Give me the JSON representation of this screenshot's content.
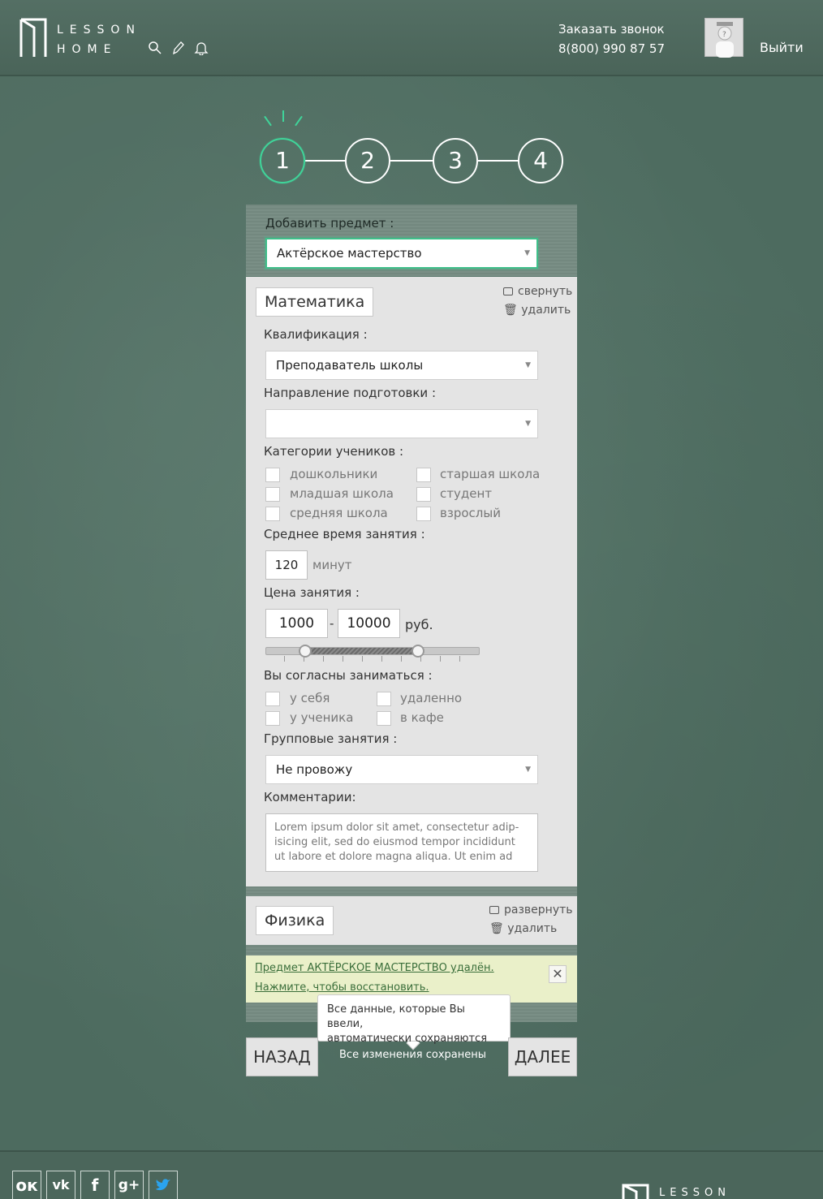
{
  "header": {
    "logo_line1": "LESSON",
    "logo_line2": "HOME",
    "callback_label": "Заказать звонок",
    "phone": "8(800) 990 87 57",
    "logout_label": "Выйти"
  },
  "steps": [
    "1",
    "2",
    "3",
    "4"
  ],
  "add_subject": {
    "label": "Добавить предмет :",
    "selected": "Актёрское мастерство"
  },
  "subject1": {
    "name": "Математика",
    "collapse_label": "свернуть",
    "delete_label": "удалить",
    "qualification_label": "Квалификация :",
    "qualification_value": "Преподаватель школы",
    "direction_label": "Направление подготовки :",
    "direction_value": "",
    "categories_label": "Категории учеников :",
    "categories": [
      "дошкольники",
      "старшая школа",
      "младшая школа",
      "студент",
      "средняя школа",
      "взрослый"
    ],
    "duration_label": "Среднее время занятия :",
    "duration_value": "120",
    "duration_unit": "минут",
    "price_label": "Цена занятия :",
    "price_min": "1000",
    "price_sep": "-",
    "price_max": "10000",
    "price_unit": "руб.",
    "location_label": "Вы согласны заниматься :",
    "locations": [
      "у себя",
      "удаленно",
      "у ученика",
      "в кафе"
    ],
    "group_label": "Групповые занятия :",
    "group_value": "Не провожу",
    "comments_label": "Комментарии:",
    "comments_value": "Lorem ipsum dolor sit amet, consectetur adip-isicing elit, sed do eiusmod tempor incididunt ut labore et dolore magna aliqua. Ut enim ad"
  },
  "subject2": {
    "name": "Физика",
    "expand_label": "развернуть",
    "delete_label": "удалить"
  },
  "notice": {
    "line1": "Предмет АКТЁРСКОЕ МАСТЕРСТВО удалён.",
    "line2": "Нажмите, чтобы восстановить.",
    "close": "✕"
  },
  "tooltip": {
    "line1": "Все данные, которые Вы ввели,",
    "line2": "автоматически сохраняются"
  },
  "nav": {
    "back_label": "НАЗАД",
    "next_label": "ДАЛЕЕ",
    "saved_label": "Все изменения сохранены"
  },
  "footer": {
    "social": [
      "ok",
      "vk",
      "f",
      "g+",
      "twitter"
    ],
    "logo": "LESSON"
  },
  "colors": {
    "accent": "#3fd59a",
    "board": "#567567",
    "notice_bg": "#eaf0c9"
  }
}
